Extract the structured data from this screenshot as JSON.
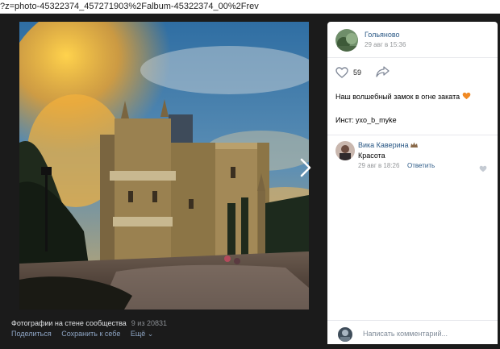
{
  "browser": {
    "url": "?z=photo-45322374_457271903%2Falbum-45322374_00%2Frev"
  },
  "photo": {
    "album_caption": "Фотографии на стене сообщества",
    "counter": "9 из 20831",
    "actions": {
      "share": "Поделиться",
      "save": "Сохранить к себе",
      "more": "Ещё ⌄"
    }
  },
  "post": {
    "author": "Гольяново",
    "date": "29 авг в 15:36",
    "likes": "59",
    "text": "Наш волшебный замок в огне заката",
    "text_emoji": "🧡",
    "inst": "Инст: yxo_b_myke"
  },
  "comment": {
    "author": "Вика Каверина",
    "author_emoji": "👑",
    "text": "Красота",
    "date": "29 авг в 18:26",
    "reply": "Ответить"
  },
  "composer": {
    "placeholder": "Написать комментарий..."
  },
  "colors": {
    "link": "#2a5885",
    "accent_orange": "#f08a24",
    "viewer_bg": "#1b1b1b"
  }
}
